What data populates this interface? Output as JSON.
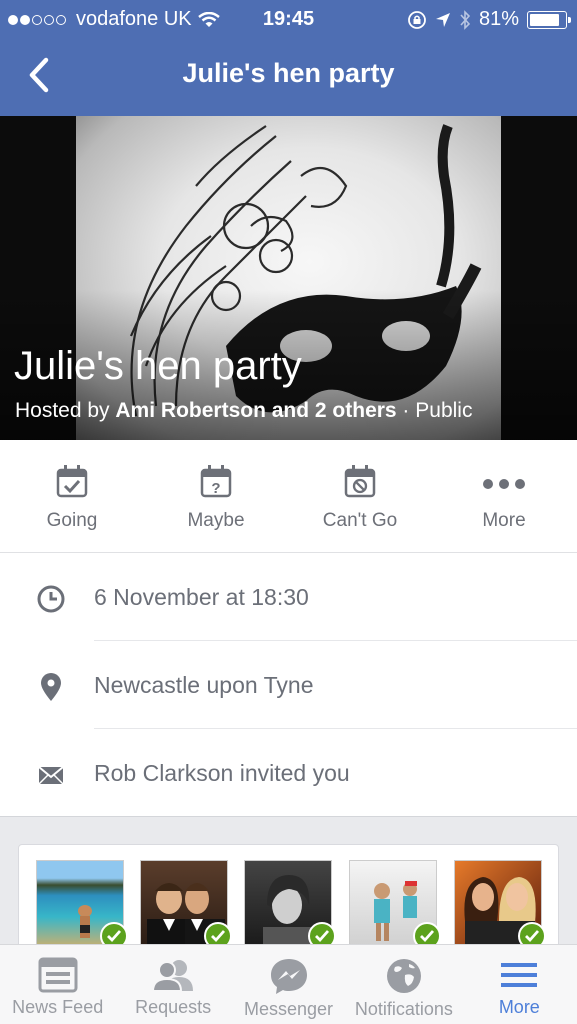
{
  "status": {
    "carrier": "vodafone UK",
    "time": "19:45",
    "battery": "81%"
  },
  "nav": {
    "title": "Julie's hen party"
  },
  "event": {
    "title": "Julie's hen party",
    "host_prefix": "Hosted by ",
    "host_names": "Ami Robertson and 2 others",
    "privacy": " · Public"
  },
  "rsvp": [
    {
      "label": "Going",
      "icon": "calendar-check-icon"
    },
    {
      "label": "Maybe",
      "icon": "calendar-question-icon"
    },
    {
      "label": "Can't Go",
      "icon": "calendar-cancel-icon"
    },
    {
      "label": "More",
      "icon": "more-dots-icon"
    }
  ],
  "details": {
    "datetime": "6 November at 18:30",
    "location": "Newcastle upon Tyne",
    "invite": "Rob Clarkson invited you"
  },
  "guests": [
    {
      "desc": "beach-photo",
      "status": "going"
    },
    {
      "desc": "two-men-suits",
      "status": "going"
    },
    {
      "desc": "bw-woman",
      "status": "going"
    },
    {
      "desc": "children-photo",
      "status": "going"
    },
    {
      "desc": "two-women-party",
      "status": "going"
    }
  ],
  "tabs": [
    {
      "label": "News Feed",
      "icon": "news-feed-icon"
    },
    {
      "label": "Requests",
      "icon": "friend-requests-icon"
    },
    {
      "label": "Messenger",
      "icon": "messenger-icon"
    },
    {
      "label": "Notifications",
      "icon": "globe-icon"
    },
    {
      "label": "More",
      "icon": "menu-icon",
      "active": true
    }
  ],
  "colors": {
    "nav_bg": "#4e6eb3",
    "active_tab": "#4d7fd9",
    "going_check": "#5ca21d"
  }
}
